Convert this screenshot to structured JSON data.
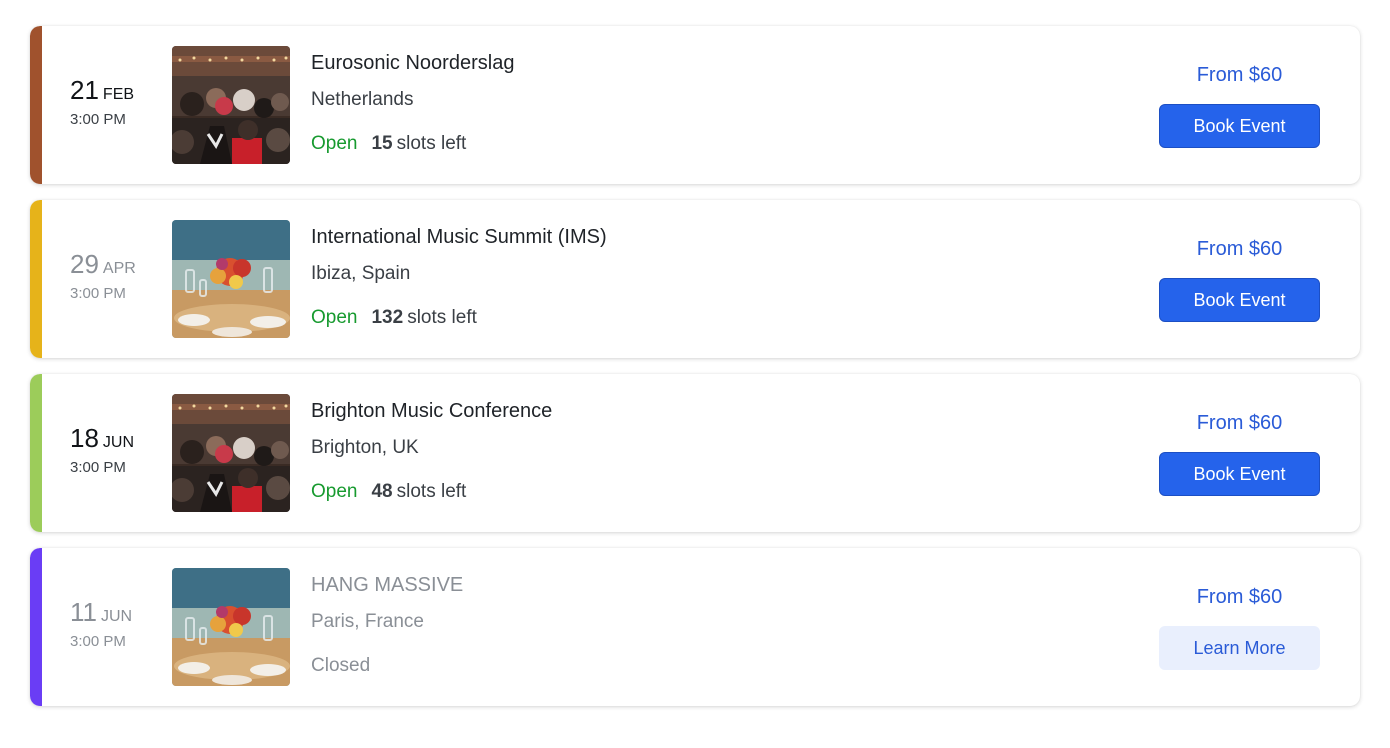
{
  "events": [
    {
      "accent_color": "#a0522d",
      "day": "21",
      "month": "FEB",
      "time": "3:00 PM",
      "image": "concert-crowd-image",
      "title": "Eurosonic Noorderslag",
      "location": "Netherlands",
      "status": "Open",
      "slots_count": "15",
      "slots_label": "slots left",
      "price": "From $60",
      "button_label": "Book Event"
    },
    {
      "accent_color": "#e6b31a",
      "day": "29",
      "month": "APR",
      "time": "3:00 PM",
      "image": "dinner-table-flowers-image",
      "title": "International Music Summit (IMS)",
      "location": "Ibiza, Spain",
      "status": "Open",
      "slots_count": "132",
      "slots_label": "slots left",
      "price": "From $60",
      "button_label": "Book Event"
    },
    {
      "accent_color": "#9ccc5a",
      "day": "18",
      "month": "JUN",
      "time": "3:00 PM",
      "image": "concert-crowd-image",
      "title": "Brighton Music Conference",
      "location": "Brighton, UK",
      "status": "Open",
      "slots_count": "48",
      "slots_label": "slots left",
      "price": "From $60",
      "button_label": "Book Event"
    },
    {
      "accent_color": "#6a3df5",
      "day": "11",
      "month": "JUN",
      "time": "3:00 PM",
      "image": "dinner-table-flowers-image",
      "title": "HANG MASSIVE",
      "location": "Paris, France",
      "status": "Closed",
      "price": "From $60",
      "button_label": "Learn More"
    }
  ],
  "colors": {
    "primary": "#2563eb",
    "open": "#179a2f",
    "muted": "#8a8f96"
  }
}
